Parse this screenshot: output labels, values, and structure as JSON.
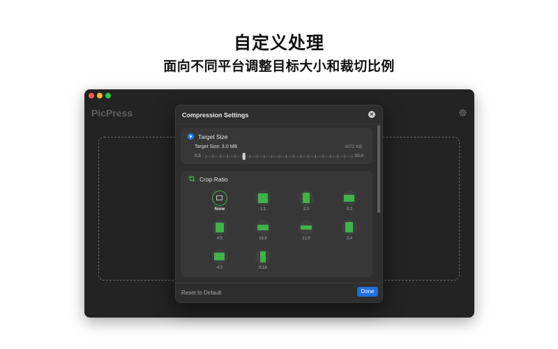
{
  "hero": {
    "title": "自定义处理",
    "subtitle": "面向不同平台调整目标大小和裁切比例"
  },
  "app": {
    "title": "PicPress",
    "settings_icon": "gear-icon"
  },
  "sheet": {
    "title": "Compression Settings",
    "close_icon": "close-icon",
    "target": {
      "label": "Target Size",
      "size_label": "Target Size: 3.0 MB",
      "size_kb": "3072 KB",
      "min": "0.5",
      "max": "10.0",
      "value": 3.0,
      "min_value": 0.5,
      "max_value": 10.0
    },
    "crop": {
      "label": "Crop Ratio",
      "icon": "crop-icon",
      "selected": "None",
      "options": [
        {
          "label": "None"
        },
        {
          "label": "1:1"
        },
        {
          "label": "2:3"
        },
        {
          "label": "3:2"
        },
        {
          "label": "4:5"
        },
        {
          "label": "16:9"
        },
        {
          "label": "21:9"
        },
        {
          "label": "3:4"
        },
        {
          "label": "4:3"
        },
        {
          "label": "9:16"
        }
      ]
    },
    "footer": {
      "reset": "Reset to Default",
      "done": "Done"
    }
  },
  "colors": {
    "accent_blue": "#1f6fe0",
    "accent_green": "#3fb24a",
    "window_bg": "#232323",
    "sheet_bg": "#2e2e2e"
  }
}
